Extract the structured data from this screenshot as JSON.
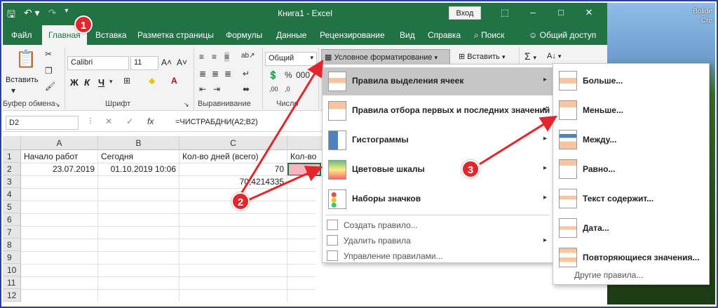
{
  "window": {
    "title": "Книга1  -  Excel",
    "sign_in": "Вход",
    "qat_icons": [
      "save-icon",
      "undo-icon",
      "redo-icon"
    ],
    "win_buttons": [
      "ribbon-display-icon",
      "minimize-icon",
      "maximize-icon",
      "close-icon"
    ]
  },
  "desktop": {
    "text_line1": "Bolide",
    "text_line2": "Cre"
  },
  "tabs": [
    "Файл",
    "Главная",
    "Вставка",
    "Разметка страницы",
    "Формулы",
    "Данные",
    "Рецензирование",
    "Вид",
    "Справка",
    "Поиск",
    "Общий доступ"
  ],
  "ribbon": {
    "paste_label": "Вставить",
    "clipboard_group": "Буфер обмена",
    "font_name": "Calibri",
    "font_size": "11",
    "bold": "Ж",
    "italic": "К",
    "underline": "Ч",
    "font_group": "Шрифт",
    "align_group": "Выравнивание",
    "number_format": "Общий",
    "number_group": "Число",
    "conditional_formatting": "Условное форматирование",
    "insert": "Вставить",
    "sum": "Σ"
  },
  "formula_bar": {
    "name_box": "D2",
    "fx": "fx",
    "formula": "=ЧИСТРАБДНИ(A2;B2)"
  },
  "grid": {
    "columns": [
      "A",
      "B",
      "C",
      "D"
    ],
    "rows": [
      "1",
      "2",
      "3",
      "4",
      "5",
      "6",
      "7",
      "8",
      "9",
      "10",
      "11",
      "12"
    ],
    "cells": {
      "A1": "Начало работ",
      "B1": "Сегодня",
      "C1": "Кол-во дней (всего)",
      "D1": "Кол-во",
      "A2": "23.07.2019",
      "B2": "01.10.2019 10:06",
      "C2": "70",
      "C3": "70,4214335"
    }
  },
  "menu_main": {
    "items": [
      {
        "label": "Правила выделения ячеек",
        "has_submenu": true,
        "icon": "highlight-rules-icon"
      },
      {
        "label": "Правила отбора первых и последних значений",
        "has_submenu": true,
        "icon": "top-bottom-icon"
      },
      {
        "label": "Гистограммы",
        "has_submenu": true,
        "icon": "data-bars-icon"
      },
      {
        "label": "Цветовые шкалы",
        "has_submenu": true,
        "icon": "color-scales-icon"
      },
      {
        "label": "Наборы значков",
        "has_submenu": true,
        "icon": "icon-sets-icon"
      }
    ],
    "small_items": [
      {
        "label": "Создать правило...",
        "has_submenu": false
      },
      {
        "label": "Удалить правила",
        "has_submenu": true
      },
      {
        "label": "Управление правилами...",
        "has_submenu": false
      }
    ]
  },
  "menu_sub": {
    "items": [
      "Больше...",
      "Меньше...",
      "Между...",
      "Равно...",
      "Текст содержит...",
      "Дата...",
      "Повторяющиеся значения..."
    ],
    "more": "Другие правила..."
  },
  "annotations": [
    "1",
    "2",
    "3"
  ],
  "colors": {
    "excel_green": "#217346",
    "highlight_fill": "#f4b6c0",
    "annotation_red": "#e3262c",
    "menu_highlight": "#c6c6c6"
  }
}
